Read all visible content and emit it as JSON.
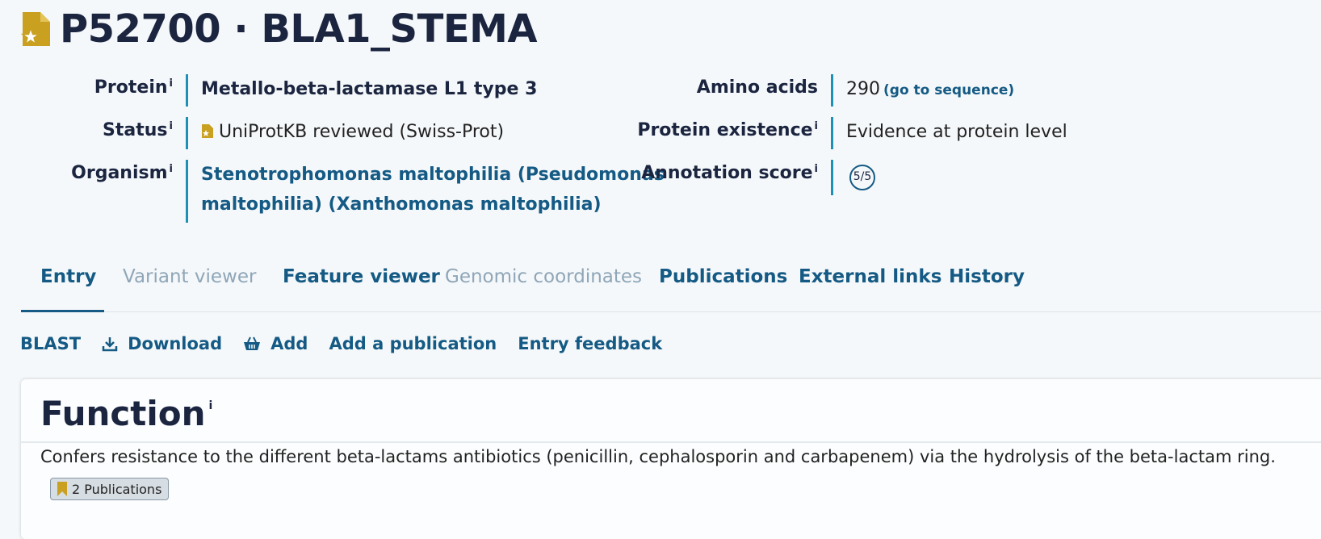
{
  "entry": {
    "title": "P52700 · BLA1_STEMA",
    "icon": "reviewed-star-document-icon",
    "icon_color": "#c9a020"
  },
  "info_left": [
    {
      "label": "Protein",
      "info": "i",
      "value": "Metallo-beta-lactamase L1 type 3"
    },
    {
      "label": "Status",
      "info": "i",
      "value": "UniProtKB reviewed (Swiss-Prot)"
    },
    {
      "label": "Organism",
      "info": "i",
      "value_line1": "Stenotrophomonas maltophilia (Pseudomonas",
      "value_line2": "maltophilia) (Xanthomonas maltophilia)"
    }
  ],
  "info_right": [
    {
      "label": "Amino acids",
      "value": "290",
      "link": "(go to sequence)"
    },
    {
      "label": "Protein existence",
      "info": "i",
      "value": "Evidence at protein level"
    },
    {
      "label": "Annotation score",
      "info": "i",
      "value": "5/5"
    }
  ],
  "tabs": [
    {
      "label": "Entry",
      "active": true
    },
    {
      "label": "Variant viewer",
      "disabled": true
    },
    {
      "label": "Feature viewer"
    },
    {
      "label": "Genomic coordinates",
      "disabled": true
    },
    {
      "label": "Publications"
    },
    {
      "label": "External links"
    },
    {
      "label": "History"
    }
  ],
  "actions": {
    "blast": "BLAST",
    "download": "Download",
    "add": "Add",
    "add_publication": "Add a publication",
    "feedback": "Entry feedback"
  },
  "function_card": {
    "title": "Function",
    "info": "i",
    "text": "Confers resistance to the different beta-lactams antibiotics (penicillin, cephalosporin and carbapenem) via the hydrolysis of the beta-lactam ring.",
    "publications_badge": "2 Publications"
  },
  "colors": {
    "link": "#145a84",
    "accent_border": "#1e90b8",
    "reviewed_gold": "#c9a020",
    "disabled_tab": "#8fa6b8"
  }
}
